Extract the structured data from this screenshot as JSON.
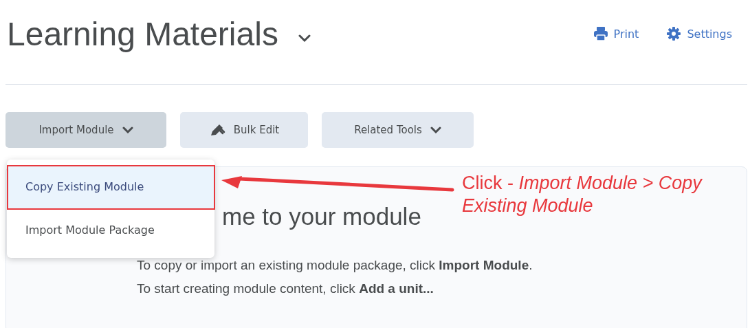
{
  "page": {
    "title": "Learning Materials"
  },
  "header_actions": [
    {
      "kind": "print",
      "label": "Print"
    },
    {
      "kind": "settings",
      "label": "Settings"
    }
  ],
  "toolbar": [
    {
      "kind": "dropdown",
      "label": "Import Module",
      "selected": true
    },
    {
      "kind": "edit",
      "label": "Bulk Edit",
      "selected": false
    },
    {
      "kind": "dropdown",
      "label": "Related Tools",
      "selected": false
    }
  ],
  "dropdown_menu": [
    {
      "label": "Copy Existing Module",
      "selected": true
    },
    {
      "label": "Import Module Package",
      "selected": false
    }
  ],
  "module_panel": {
    "heading": "me to your module",
    "lines": [
      "To copy or import an existing module package, click **Import Module**.",
      "To start creating module content, click **Add a unit...**"
    ]
  },
  "annotation": {
    "text": "Click - *Import Module > Copy Existing Module*"
  }
}
